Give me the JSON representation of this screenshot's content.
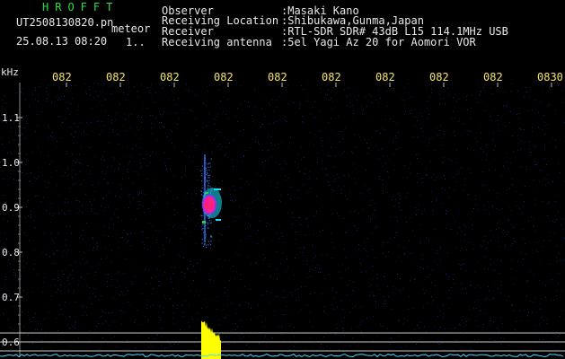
{
  "header": {
    "app_name": "HROFFT",
    "filename": "UT2508130820.pn",
    "event_label": "meteor",
    "datetime": "25.08.13 08:20",
    "counter": "1..",
    "observer_label": "Observer",
    "observer_value": ":Masaki Kano",
    "location_label": "Receiving Location",
    "location_value": ":Shibukawa,Gunma,Japan",
    "receiver_label": "Receiver",
    "receiver_value": ":RTL-SDR SDR# 43dB L15 114.1MHz USB",
    "antenna_label": "Receiving antenna",
    "antenna_value": ":5el Yagi Az 20 for Aomori VOR"
  },
  "axes": {
    "unit_label": "kHz",
    "y_ticks": [
      "1.1",
      "1.0",
      "0.9",
      "0.8",
      "0.7",
      "0.6"
    ],
    "x_ticks": [
      "082",
      "082",
      "082",
      "082",
      "082",
      "082",
      "082",
      "082",
      "082",
      "0830"
    ]
  },
  "colors": {
    "background": "#000000",
    "noise": "#0a2a8a",
    "echo_core": "#ff2080",
    "echo_edge": "#18e0ff",
    "signal_level": "#ffff00",
    "baseline": "#4ad8ff",
    "text": "#e8e8e8",
    "tick_label": "#f4e36a",
    "title": "#27e04a"
  }
}
